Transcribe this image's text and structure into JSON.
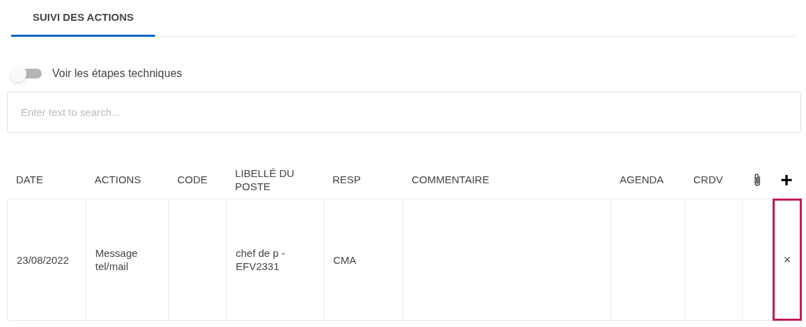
{
  "tabs": [
    {
      "label": "SUIVI DES ACTIONS",
      "selected": true
    }
  ],
  "toggle": {
    "label": "Voir les étapes techniques",
    "on": false
  },
  "search": {
    "placeholder": "Enter text to search..."
  },
  "table": {
    "columns": [
      {
        "kind": "text",
        "label": "DATE"
      },
      {
        "kind": "text",
        "label": "ACTIONS"
      },
      {
        "kind": "text",
        "label": "CODE"
      },
      {
        "kind": "text",
        "label": "LIBELLÉ DU POSTE"
      },
      {
        "kind": "text",
        "label": "RESP"
      },
      {
        "kind": "text",
        "label": "COMMENTAIRE"
      },
      {
        "kind": "text",
        "label": "AGENDA"
      },
      {
        "kind": "text",
        "label": "CRDV"
      },
      {
        "kind": "attachment"
      },
      {
        "kind": "add",
        "label": "+"
      }
    ],
    "rows": [
      {
        "cells": [
          "23/08/2022",
          "Message tel/mail",
          "",
          "chef de p - EFV2331",
          "CMA",
          "",
          "",
          "",
          ""
        ],
        "delete": {
          "label": "×",
          "focused": true
        }
      }
    ]
  }
}
